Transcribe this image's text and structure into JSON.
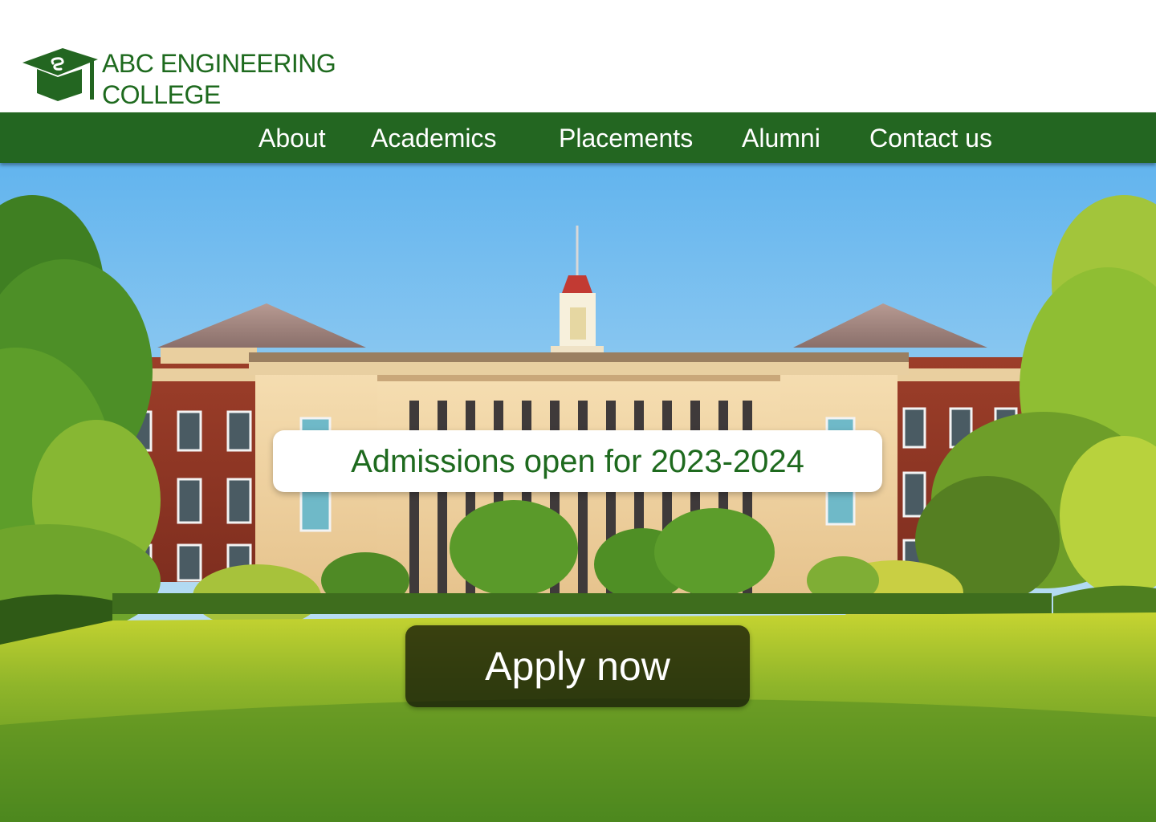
{
  "brand": {
    "line1": "ABC ENGINEERING",
    "line2": "COLLEGE",
    "logo_icon": "graduation-cap-icon",
    "brand_color": "#1e6a1e"
  },
  "nav": {
    "background": "#236621",
    "items": [
      {
        "label": "About"
      },
      {
        "label": "Academics"
      },
      {
        "label": "Placements"
      },
      {
        "label": "Alumni"
      },
      {
        "label": "Contact us"
      }
    ]
  },
  "hero": {
    "image": "college-building-photo",
    "banner_text": "Admissions open for 2023-2024",
    "cta_label": "Apply now"
  }
}
